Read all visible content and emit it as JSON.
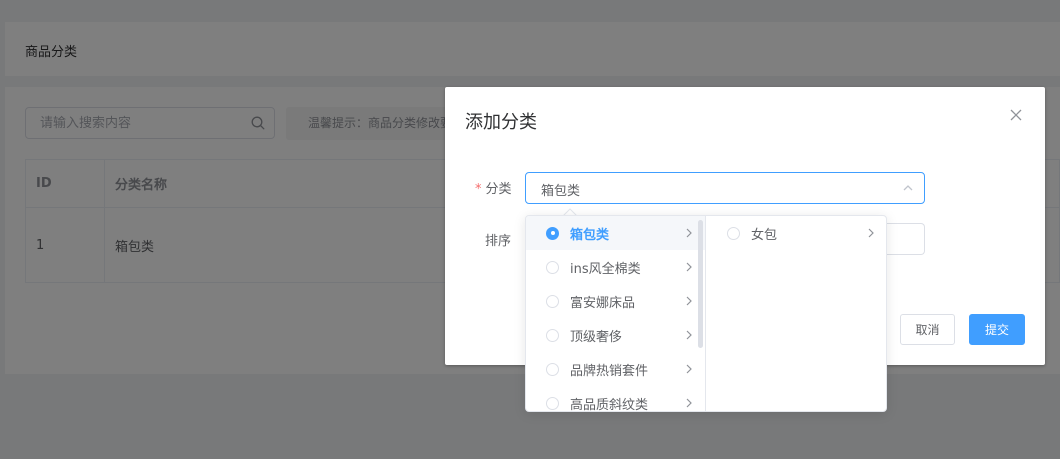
{
  "page": {
    "title": "商品分类"
  },
  "search": {
    "placeholder": "请输入搜索内容"
  },
  "tip": {
    "text": "温馨提示：商品分类修改要"
  },
  "table": {
    "columns": [
      "ID",
      "分类名称"
    ],
    "rows": [
      {
        "id": "1",
        "name": "箱包类"
      }
    ]
  },
  "dialog": {
    "title": "添加分类",
    "category_label": "分类",
    "category_value": "箱包类",
    "sort_label": "排序",
    "cancel_label": "取消",
    "submit_label": "提交"
  },
  "cascader": {
    "level1": [
      "箱包类",
      "ins风全棉类",
      "富安娜床品",
      "顶级奢侈",
      "品牌热销套件",
      "高品质斜纹类"
    ],
    "level1_selected": "箱包类",
    "level2": [
      "女包"
    ]
  },
  "icons": {
    "search": "search-icon",
    "close": "close-icon",
    "arrow_up": "chevron-up-icon",
    "expand": "chevron-right-icon"
  },
  "colors": {
    "primary": "#409eff",
    "danger": "#f56c6c",
    "overlay": "rgba(0,0,0,0.5)"
  }
}
